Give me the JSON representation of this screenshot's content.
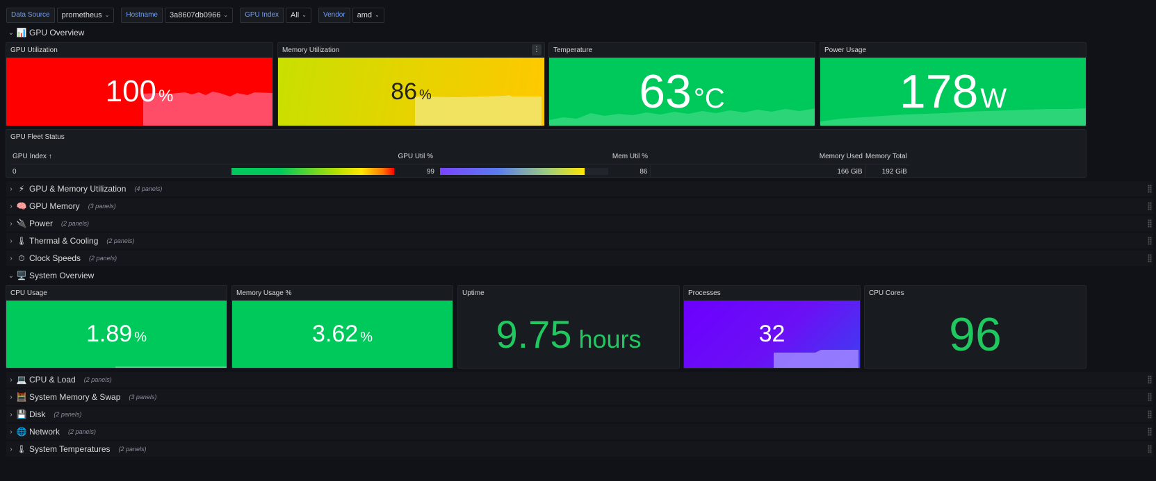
{
  "variables": [
    {
      "label": "Data Source",
      "value": "prometheus"
    },
    {
      "label": "Hostname",
      "value": "3a8607db0966"
    },
    {
      "label": "GPU Index",
      "value": "All"
    },
    {
      "label": "Vendor",
      "value": "amd"
    }
  ],
  "gpu_overview": {
    "title": "GPU Overview",
    "emoji": "📊",
    "stats": {
      "gpu_util": {
        "title": "GPU Utilization",
        "value": "100",
        "unit": "%",
        "color": "#ff0000"
      },
      "mem_util": {
        "title": "Memory Utilization",
        "value": "86",
        "unit": "%",
        "color": "#e6d300"
      },
      "temperature": {
        "title": "Temperature",
        "value": "63",
        "unit": "°C",
        "color": "#00c95b"
      },
      "power": {
        "title": "Power Usage",
        "value": "178",
        "unit": "W",
        "color": "#00c95b"
      }
    },
    "menu_icon": "⋮"
  },
  "fleet": {
    "title": "GPU Fleet Status",
    "columns": {
      "index": "GPU Index",
      "sort_icon": "↑",
      "gpu_util": "GPU Util %",
      "mem_util": "Mem Util %",
      "mem_used": "Memory Used",
      "mem_total": "Memory Total"
    },
    "rows": [
      {
        "index": "0",
        "gpu_util": "99",
        "gpu_util_level": 0.99,
        "mem_util": "86",
        "mem_util_level": 0.86,
        "mem_used": "166 GiB",
        "mem_total": "192 GiB"
      }
    ]
  },
  "gpu_rows": [
    {
      "emoji": "⚡",
      "title": "GPU & Memory Utilization",
      "count": "(4 panels)"
    },
    {
      "emoji": "🧠",
      "title": "GPU Memory",
      "count": "(3 panels)"
    },
    {
      "emoji": "🔌",
      "title": "Power",
      "count": "(2 panels)"
    },
    {
      "emoji": "🌡",
      "title": "Thermal & Cooling",
      "count": "(2 panels)"
    },
    {
      "emoji": "⏱",
      "title": "Clock Speeds",
      "count": "(2 panels)"
    }
  ],
  "system_overview": {
    "title": "System Overview",
    "emoji": "🖥️",
    "stats": {
      "cpu": {
        "title": "CPU Usage",
        "value": "1.89",
        "unit": "%"
      },
      "mem": {
        "title": "Memory Usage %",
        "value": "3.62",
        "unit": "%"
      },
      "uptime": {
        "title": "Uptime",
        "value": "9.75",
        "unit": "hours"
      },
      "processes": {
        "title": "Processes",
        "value": "32"
      },
      "cores": {
        "title": "CPU Cores",
        "value": "96"
      }
    }
  },
  "system_rows": [
    {
      "emoji": "💻",
      "title": "CPU & Load",
      "count": "(2 panels)"
    },
    {
      "emoji": "🧮",
      "title": "System Memory & Swap",
      "count": "(3 panels)"
    },
    {
      "emoji": "💾",
      "title": "Disk",
      "count": "(2 panels)"
    },
    {
      "emoji": "🌐",
      "title": "Network",
      "count": "(2 panels)"
    },
    {
      "emoji": "🌡",
      "title": "System Temperatures",
      "count": "(2 panels)"
    }
  ],
  "icons": {
    "expand": "chevron-down-icon",
    "collapse": "chevron-right-icon",
    "drag": "drag-handle-icon"
  }
}
